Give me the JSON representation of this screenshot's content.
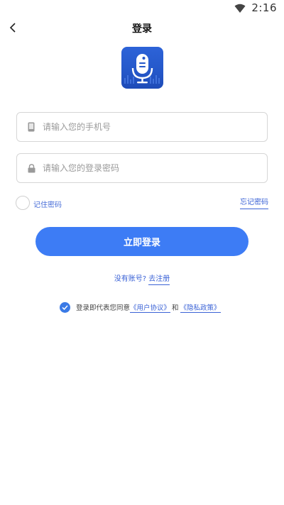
{
  "status_bar": {
    "time": "2:16"
  },
  "nav": {
    "title": "登录"
  },
  "phone_field": {
    "placeholder": "请输入您的手机号"
  },
  "password_field": {
    "placeholder": "请输入您的登录密码"
  },
  "remember": {
    "label": "记住密码",
    "forgot_label": "忘记密码"
  },
  "login_button": {
    "label": "立即登录"
  },
  "register": {
    "question": "没有账号?",
    "link": "去注册"
  },
  "agreement": {
    "prefix": "登录即代表您同意",
    "user_agreement": "《用户协议》",
    "and": "和",
    "privacy_policy": "《隐私政策》",
    "checked": true
  },
  "colors": {
    "primary": "#3d7cf5",
    "link": "#3a62d6",
    "logo_bg": "#2457c9"
  }
}
